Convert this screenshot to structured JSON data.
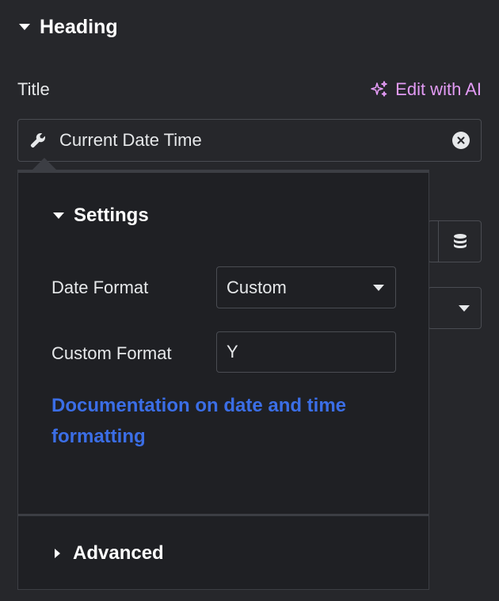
{
  "section": {
    "title": "Heading"
  },
  "title_field": {
    "label": "Title",
    "ai_link_label": "Edit with AI",
    "dynamic_tag_value": "Current Date Time"
  },
  "popover": {
    "settings_title": "Settings",
    "date_format": {
      "label": "Date Format",
      "value": "Custom"
    },
    "custom_format": {
      "label": "Custom Format",
      "value": "Y"
    },
    "doc_link": "Documentation on date and time formatting",
    "advanced_title": "Advanced"
  },
  "colors": {
    "background": "#26272b",
    "popover_background": "#1f2024",
    "ai_accent": "#e39bf5",
    "link": "#3b6ee6",
    "border": "#4a4c52"
  },
  "icons": [
    "caret-down-icon",
    "sparkle-icon",
    "wrench-icon",
    "clear-icon",
    "database-icon",
    "caret-right-icon"
  ]
}
